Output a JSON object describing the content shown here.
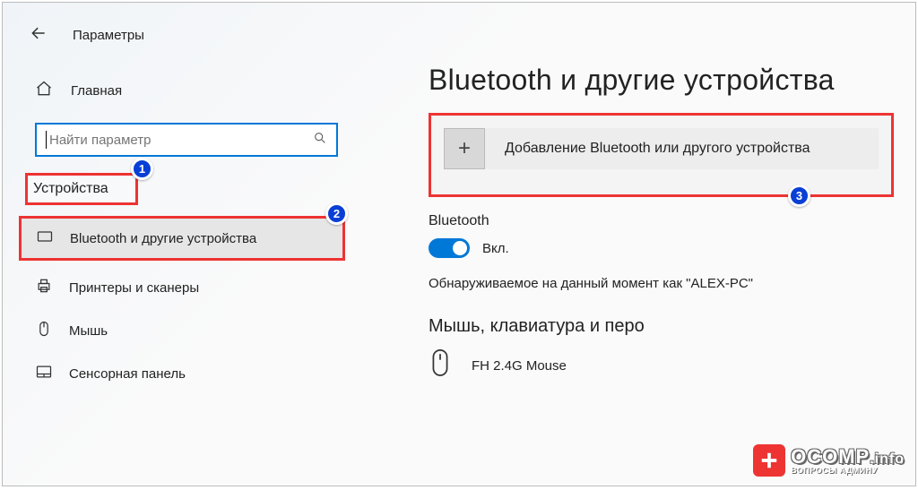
{
  "header": {
    "title": "Параметры"
  },
  "sidebar": {
    "home": "Главная",
    "search_placeholder": "Найти параметр",
    "category": "Устройства",
    "items": [
      {
        "label": "Bluetooth и другие устройства"
      },
      {
        "label": "Принтеры и сканеры"
      },
      {
        "label": "Мышь"
      },
      {
        "label": "Сенсорная панель"
      }
    ]
  },
  "content": {
    "title": "Bluetooth и другие устройства",
    "add_device": "Добавление Bluetooth или другого устройства",
    "bt_label": "Bluetooth",
    "bt_state": "Вкл.",
    "discover": "Обнаруживаемое на данный момент как \"ALEX-PC\"",
    "section": "Мышь, клавиатура и перо",
    "device": "FH 2.4G Mouse"
  },
  "badges": {
    "b1": "1",
    "b2": "2",
    "b3": "3"
  },
  "watermark": {
    "brand": "OCOMP",
    "suffix": ".info",
    "tag": "ВОПРОСЫ АДМИНУ"
  }
}
